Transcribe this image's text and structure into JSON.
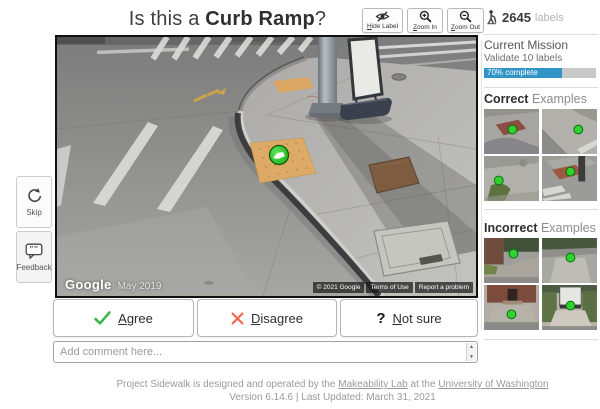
{
  "header": {
    "title": {
      "prefix": "Is this a ",
      "bold": "Curb Ramp",
      "suffix": "?"
    },
    "buttons": [
      {
        "first": "H",
        "rest": "ide Label"
      },
      {
        "first": "Z",
        "rest": "oom In"
      },
      {
        "first": "Z",
        "rest": "oom Out"
      }
    ]
  },
  "stats": {
    "count": "2645",
    "unit": "labels"
  },
  "mission": {
    "title": "Current Mission",
    "subtitle": "Validate 10 labels",
    "progress_percent": 70,
    "progress_text": "70% complete"
  },
  "examples": {
    "correct_bold": "Correct",
    "correct_rest": " Examples",
    "incorrect_bold": "Incorrect",
    "incorrect_rest": " Examples"
  },
  "viewer": {
    "google": "Google",
    "date": "May 2019",
    "badges": [
      "© 2021 Google",
      "Terms of Use",
      "Report a problem"
    ]
  },
  "side": {
    "skip": "Skip",
    "feedback": "Feedback"
  },
  "answers": [
    {
      "first": "A",
      "rest": "gree"
    },
    {
      "first": "D",
      "rest": "isagree"
    },
    {
      "first": "N",
      "rest": "ot sure"
    }
  ],
  "comment": {
    "placeholder": "Add comment here..."
  },
  "footer": {
    "text1": "Project Sidewalk is designed and operated by the ",
    "link1": "Makeability Lab",
    "text2": " at the ",
    "link2": "University of Washington",
    "line2": "Version 6.14.6 | Last Updated: March 31, 2021"
  },
  "colors": {
    "progress_blue": "#3094c6",
    "agree_green": "#3eb54d",
    "disagree_red": "#f1654c"
  }
}
